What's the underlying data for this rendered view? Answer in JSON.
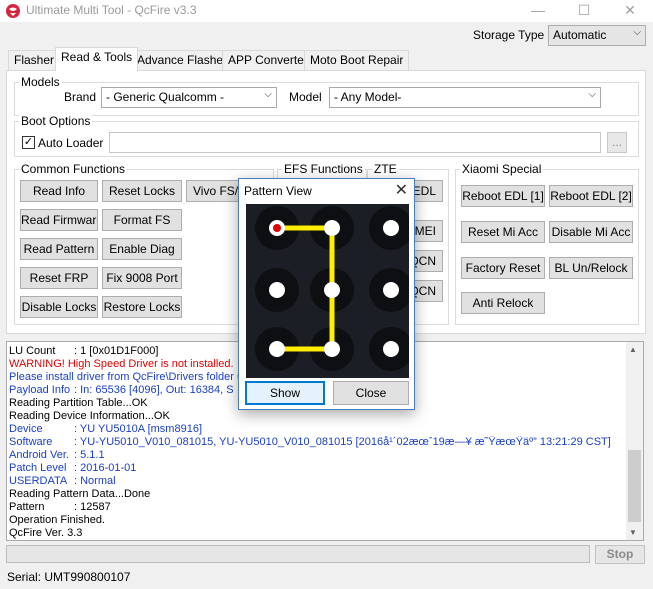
{
  "window": {
    "title": "Ultimate Multi Tool - QcFire v3.3",
    "minimize_glyph": "—",
    "maximize_glyph": "☐",
    "close_glyph": "✕"
  },
  "storage": {
    "label": "Storage Type",
    "value": "Automatic"
  },
  "tabs": [
    "Flasher",
    "Read & Tools",
    "Advance Flasher",
    "APP Converter",
    "Moto Boot Repair"
  ],
  "active_tab": "Read & Tools",
  "models": {
    "group_title": "Models",
    "brand_label": "Brand",
    "brand_value": "- Generic Qualcomm -",
    "model_label": "Model",
    "model_value": "- Any Model-"
  },
  "boot_options": {
    "group_title": "Boot Options",
    "auto_loader_label": "Auto Loader",
    "auto_loader_checked": true,
    "loader_path": "",
    "browse_label": "..."
  },
  "common_functions": {
    "group_title": "Common Functions",
    "buttons": [
      "Read Info",
      "Reset Locks",
      "Vivo FS/",
      "Read Firmware",
      "Format FS",
      "Read Pattern",
      "Enable Diag",
      "Reset FRP",
      "Fix 9008 Port",
      "Disable Locks",
      "Restore Locks"
    ]
  },
  "efs_functions": {
    "group_title": "EFS Functions"
  },
  "zte": {
    "group_title": "ZTE",
    "buttons": [
      "EDL",
      "IMEI",
      "QCN",
      "QCN"
    ]
  },
  "xiaomi": {
    "group_title": "Xiaomi Special",
    "buttons": [
      "Reboot EDL [1]",
      "Reboot EDL [2]",
      "Reset Mi Acc",
      "Disable Mi Acc",
      "Factory Reset",
      "BL Un/Relock",
      "Anti Relock"
    ]
  },
  "log": {
    "lines": [
      {
        "k": "LU Count",
        "v": ": 1 [0x01D1F000]",
        "color": "#000000"
      },
      {
        "k": "",
        "v": "WARNING! High Speed Driver is not installed.",
        "color": "#e00000"
      },
      {
        "k": "",
        "v": "Please install driver from QcFire\\Drivers folder u",
        "color": "#1a3fc7"
      },
      {
        "k": "Payload Info",
        "v": ": In: 65536 [4096], Out: 16384, S",
        "color": "#1a3fc7"
      },
      {
        "k": "",
        "v": "Reading Partition Table...OK",
        "color": "#000000"
      },
      {
        "k": "",
        "v": "Reading Device Information...OK",
        "color": "#000000"
      },
      {
        "k": "Device",
        "v": ": YU YU5010A [msm8916]",
        "color": "#1a3fc7"
      },
      {
        "k": "Software",
        "v": ": YU-YU5010_V010_081015, YU-YU5010_V010_081015 [2016å¹´02æœˆ19æ—¥ æ˜ŸæœŸäº” 13:21:29 CST]",
        "color": "#1a3fc7"
      },
      {
        "k": "Android Ver.",
        "v": ": 5.1.1",
        "color": "#1a3fc7"
      },
      {
        "k": "Patch Level",
        "v": ": 2016-01-01",
        "color": "#1a3fc7"
      },
      {
        "k": "USERDATA",
        "v": ": Normal",
        "color": "#1a3fc7"
      },
      {
        "k": "",
        "v": "Reading Pattern Data...Done",
        "color": "#000000"
      },
      {
        "k": "Pattern",
        "v": ": 12587",
        "color": "#000000"
      },
      {
        "k": "",
        "v": "Operation Finished.",
        "color": "#000000"
      },
      {
        "k": "",
        "v": "QcFire Ver. 3.3",
        "color": "#000000"
      }
    ]
  },
  "stop_label": "Stop",
  "progress_fraction": 0,
  "serial": "Serial: UMT990800107",
  "pattern_dialog": {
    "title": "Pattern View",
    "close_glyph": "✕",
    "show_label": "Show",
    "close_label": "Close",
    "pattern": "12587",
    "line_color": "#ffee00",
    "start_dot_color": "#e00000"
  }
}
